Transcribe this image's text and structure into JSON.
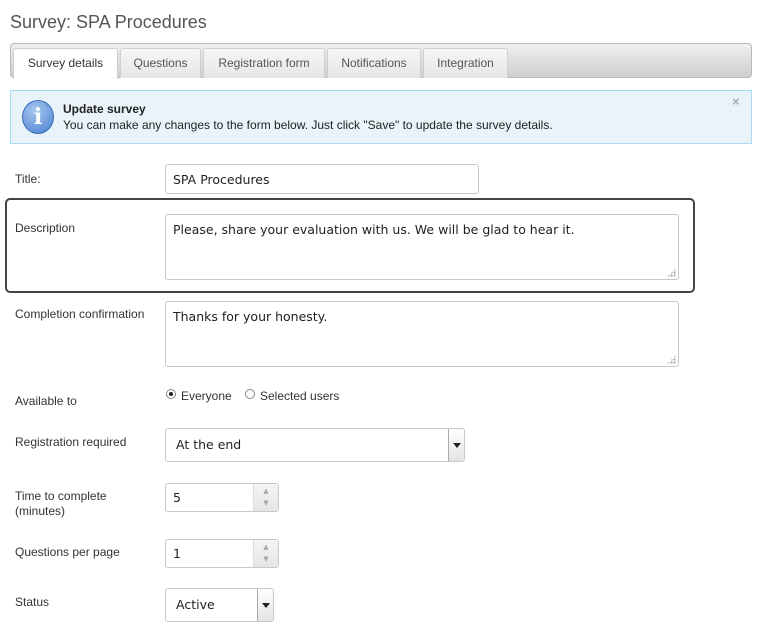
{
  "header": {
    "title": "Survey: SPA Procedures"
  },
  "tabs": [
    {
      "label": "Survey details",
      "active": true
    },
    {
      "label": "Questions"
    },
    {
      "label": "Registration form"
    },
    {
      "label": "Notifications"
    },
    {
      "label": "Integration"
    }
  ],
  "info": {
    "icon": "info-icon",
    "title": "Update survey",
    "text": "You can make any changes to the form below. Just click \"Save\" to update the survey details.",
    "close": "×"
  },
  "form": {
    "title": {
      "label": "Title:",
      "value": "SPA Procedures"
    },
    "description": {
      "label": "Description",
      "value": "Please, share your evaluation with us. We will be glad to hear it."
    },
    "completion": {
      "label": "Completion confirmation",
      "value": "Thanks for your honesty."
    },
    "available": {
      "label": "Available to",
      "options": [
        "Everyone",
        "Selected users"
      ],
      "selected": "Everyone"
    },
    "registration": {
      "label": "Registration required",
      "value": "At the end"
    },
    "time": {
      "label_line1": "Time to complete",
      "label_line2": "(minutes)",
      "value": "5"
    },
    "per_page": {
      "label": "Questions per page",
      "value": "1"
    },
    "status": {
      "label": "Status",
      "value": "Active"
    }
  },
  "colors": {
    "info_bg": "#e8f4fa",
    "info_border": "#a9dcf2",
    "highlight": "#444444"
  }
}
